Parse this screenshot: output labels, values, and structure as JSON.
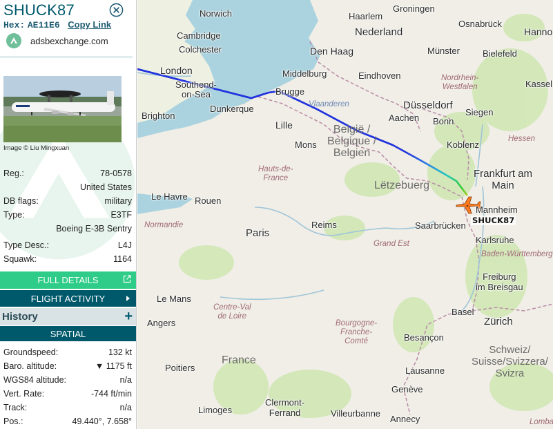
{
  "sidebar": {
    "callsign": "SHUCK87",
    "hex_label": "Hex:",
    "hex_value": "AE11E6",
    "copy_link": "Copy Link",
    "site_name": "adsbexchange.com",
    "photo_credit": "Image © Liu Mingxuan",
    "details": [
      {
        "key": "Reg.:",
        "value": "78-0578"
      },
      {
        "key": "",
        "value": "United States"
      },
      {
        "key": "DB flags:",
        "value": "military"
      },
      {
        "key": "Type:",
        "value": "E3TF"
      },
      {
        "key": "",
        "value": "Boeing E-3B Sentry"
      },
      {
        "key": "Type Desc.:",
        "value": "L4J"
      },
      {
        "key": "Squawk:",
        "value": "1164"
      }
    ],
    "full_details_button": "FULL DETAILS",
    "flight_activity_button": "FLIGHT ACTIVITY",
    "history_label": "History",
    "spatial_label": "SPATIAL",
    "spatial": [
      {
        "key": "Groundspeed:",
        "value": "132 kt"
      },
      {
        "key": "Baro. altitude:",
        "value": "▼ 1175 ft"
      },
      {
        "key": "WGS84 altitude:",
        "value": "n/a"
      },
      {
        "key": "Vert. Rate:",
        "value": "-744 ft/min"
      },
      {
        "key": "Track:",
        "value": "n/a"
      },
      {
        "key": "Pos.:",
        "value": "49.440°, 7.658°"
      }
    ],
    "icons": {
      "close": "close-circle-icon",
      "site": "adsbx-logo-icon",
      "external": "external-link-icon",
      "arrow": "chevron-right-icon",
      "add": "plus-icon"
    }
  },
  "map": {
    "aircraft_label": "SHUCK87",
    "cities": {
      "norwich": "Norwich",
      "haarlem": "Haarlem",
      "groningen": "Groningen",
      "cambridge": "Cambridge",
      "osnabruck": "Osnabrück",
      "hanno": "Hanno",
      "nederland": "Nederland",
      "colchester": "Colchester",
      "den_haag": "Den Haag",
      "munster": "Münster",
      "bielefeld": "Bielefeld",
      "london": "London",
      "middelburg": "Middelburg",
      "eindhoven": "Eindhoven",
      "southend": "Southend-\non-Sea",
      "kassel": "Kassel",
      "brugge": "Brugge",
      "dusseldorf": "Düsseldorf",
      "dunkerque": "Dunkerque",
      "brighton": "Brighton",
      "siegen": "Siegen",
      "aachen": "Aachen",
      "bonn": "Bonn",
      "lille": "Lille",
      "belgie": "België /\nBelgique /\nBelgien",
      "mons": "Mons",
      "koblenz": "Koblenz",
      "frankfurt": "Frankfurt am\nMain",
      "letzebuerg": "Lëtzebuerg",
      "le_havre": "Le Havre",
      "rouen": "Rouen",
      "mannheim": "Mannheim",
      "saarbrucken": "Saarbrücken",
      "reims": "Reims",
      "paris": "Paris",
      "karlsruhe": "Karlsruhe",
      "le_mans": "Le Mans",
      "freiburg": "Freiburg\nim Breisgau",
      "basel": "Basel",
      "angers": "Angers",
      "zurich": "Zürich",
      "besancon": "Besançon",
      "france": "France",
      "schweiz": "Schweiz/\nSuisse/Svizzera/\nSvizra",
      "poitiers": "Poitiers",
      "lausanne": "Lausanne",
      "geneve": "Genève",
      "limoges": "Limoges",
      "clermont": "Clermont-\nFerrand",
      "villeurbanne": "Villeurbanne",
      "annecy": "Annecy",
      "lombar": "Lombar"
    },
    "regions": {
      "vlaanderen": "Vlaanderen",
      "nordrhein": "Nordrhein-\nWestfalen",
      "hessen": "Hessen",
      "hauts_de_france": "Hauts-de-\nFrance",
      "normandie": "Normandie",
      "grand_est": "Grand Est",
      "baden": "Baden-Württemberg",
      "centre": "Centre-Val\nde Loire",
      "bourgogne": "Bourgogne-\nFranche-\nComté"
    },
    "colors": {
      "sea": "#aad3df",
      "land": "#f0eee6",
      "forest": "#cfe6b2",
      "route_blue": "#2233dd",
      "route_green": "#33cc33",
      "route_yellow": "#cccc22",
      "aircraft": "#ff7a22"
    }
  }
}
